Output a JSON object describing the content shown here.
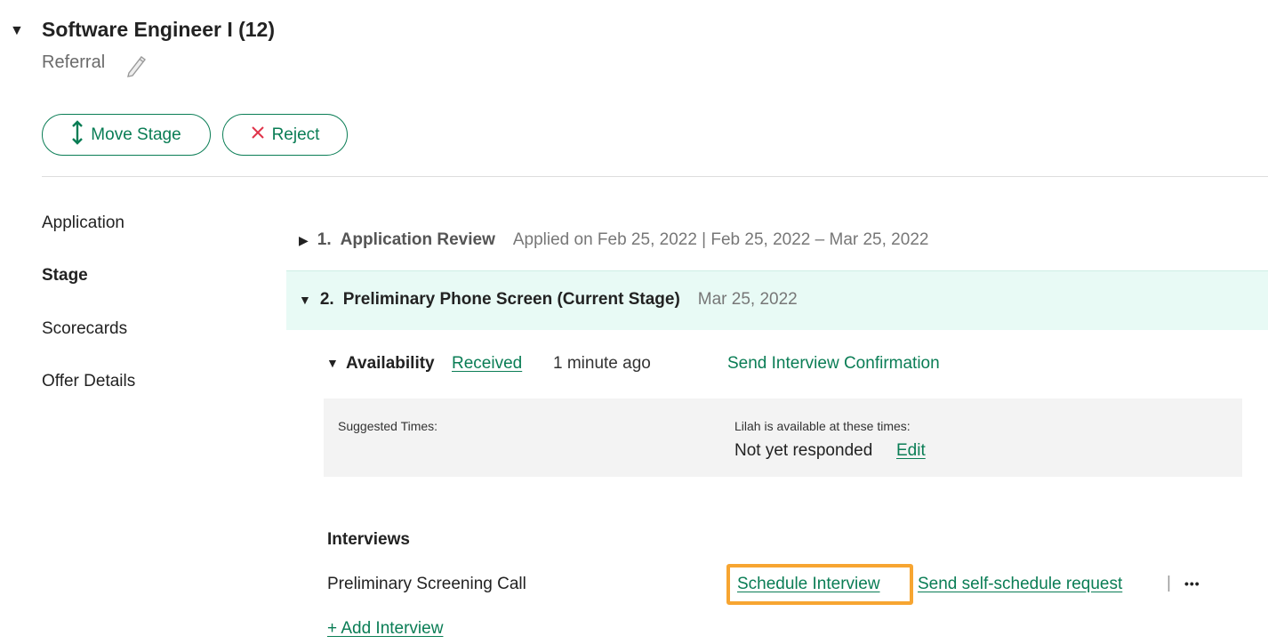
{
  "job": {
    "title": "Software Engineer I (12)",
    "source": "Referral"
  },
  "actions": {
    "move_stage": "Move Stage",
    "reject": "Reject"
  },
  "sidebar": {
    "items": [
      {
        "label": "Application"
      },
      {
        "label": "Stage",
        "active": true
      },
      {
        "label": "Scorecards"
      },
      {
        "label": "Offer Details"
      }
    ]
  },
  "stages": [
    {
      "number": "1.",
      "name": "Application Review",
      "meta": "Applied on Feb 25, 2022 | Feb 25, 2022 – Mar 25, 2022"
    },
    {
      "number": "2.",
      "name": "Preliminary Phone Screen (Current Stage)",
      "meta": "Mar 25, 2022"
    }
  ],
  "availability": {
    "label": "Availability",
    "status": "Received",
    "time": "1 minute ago",
    "confirm": "Send Interview Confirmation",
    "suggested_label": "Suggested Times:",
    "candidate_label": "Lilah is available at these times:",
    "candidate_value": "Not yet responded",
    "edit": "Edit"
  },
  "interviews": {
    "heading": "Interviews",
    "items": [
      {
        "name": "Preliminary Screening Call",
        "schedule": "Schedule Interview",
        "self_schedule": "Send self-schedule request",
        "separator": "|",
        "more": "•••"
      }
    ],
    "add": "+ Add Interview"
  },
  "colors": {
    "accent": "#0a7d55",
    "highlight": "#f7a531",
    "current_stage_bg": "#e8faf5"
  }
}
